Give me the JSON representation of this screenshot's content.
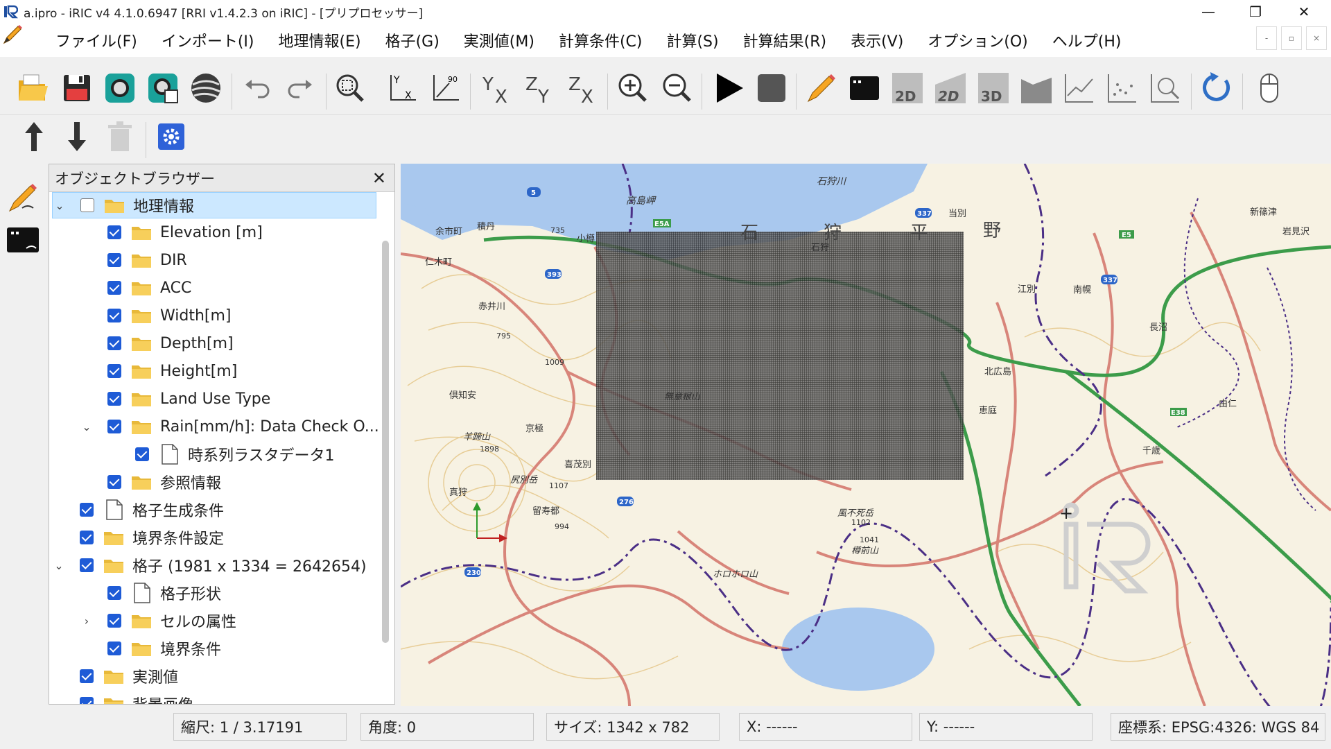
{
  "window": {
    "title": "a.ipro - iRIC v4 4.1.0.6947 [RRI v1.4.2.3 on iRIC] - [プリプロセッサー]"
  },
  "menu": [
    "ファイル(F)",
    "インポート(I)",
    "地理情報(E)",
    "格子(G)",
    "実測値(M)",
    "計算条件(C)",
    "計算(S)",
    "計算結果(R)",
    "表示(V)",
    "オプション(O)",
    "ヘルプ(H)"
  ],
  "toolbar": {
    "icons": [
      "open-folder",
      "save",
      "camera-snapshot",
      "continuous-snapshot",
      "google-earth",
      "undo",
      "redo",
      "zoom-fit",
      "view-xy",
      "view-rotate-90",
      "axis-yx",
      "axis-zy",
      "axis-zx",
      "zoom-in",
      "zoom-out",
      "run",
      "stop",
      "edit-pencil",
      "terminal",
      "2d",
      "2d-surface",
      "3d",
      "graph-area",
      "line-graph",
      "scatter-graph",
      "probe",
      "refresh",
      "mouse-help"
    ],
    "labels": {
      "view_2d": "2D",
      "view_2d_surface": "2D",
      "view_3d": "3D"
    }
  },
  "toolbar2": {
    "icons": [
      "move-up",
      "move-down",
      "delete",
      "settings"
    ]
  },
  "object_browser": {
    "title": "オブジェクトブラウザー",
    "items": [
      {
        "label": "地理情報",
        "level": 0,
        "expanded": true,
        "checked": false,
        "icon": "folder",
        "selected": true
      },
      {
        "label": "Elevation [m]",
        "level": 1,
        "checked": true,
        "icon": "folder"
      },
      {
        "label": "DIR",
        "level": 1,
        "checked": true,
        "icon": "folder"
      },
      {
        "label": "ACC",
        "level": 1,
        "checked": true,
        "icon": "folder"
      },
      {
        "label": "Width[m]",
        "level": 1,
        "checked": true,
        "icon": "folder"
      },
      {
        "label": "Depth[m]",
        "level": 1,
        "checked": true,
        "icon": "folder"
      },
      {
        "label": "Height[m]",
        "level": 1,
        "checked": true,
        "icon": "folder"
      },
      {
        "label": "Land Use Type",
        "level": 1,
        "checked": true,
        "icon": "folder"
      },
      {
        "label": "Rain[mm/h]: Data Check O...",
        "level": 1,
        "expanded": true,
        "checked": true,
        "icon": "folder"
      },
      {
        "label": "時系列ラスタデータ1",
        "level": 2,
        "checked": true,
        "icon": "document"
      },
      {
        "label": "参照情報",
        "level": 1,
        "checked": true,
        "icon": "folder"
      },
      {
        "label": "格子生成条件",
        "level": 0,
        "checked": true,
        "icon": "document"
      },
      {
        "label": "境界条件設定",
        "level": 0,
        "checked": true,
        "icon": "folder"
      },
      {
        "label": "格子 (1981 x 1334 = 2642654)",
        "level": 0,
        "expanded": true,
        "checked": true,
        "icon": "folder"
      },
      {
        "label": "格子形状",
        "level": 1,
        "checked": true,
        "icon": "document"
      },
      {
        "label": "セルの属性",
        "level": 1,
        "collapsed": true,
        "checked": true,
        "icon": "folder"
      },
      {
        "label": "境界条件",
        "level": 1,
        "checked": true,
        "icon": "folder"
      },
      {
        "label": "実測値",
        "level": 0,
        "checked": true,
        "icon": "folder"
      },
      {
        "label": "背景画像",
        "level": 0,
        "checked": true,
        "icon": "folder"
      }
    ]
  },
  "map": {
    "labels": [
      "石狩川",
      "高島岬",
      "余市町",
      "積丹",
      "小樽",
      "仁木町",
      "赤井川",
      "石狩",
      "当別",
      "新篠津",
      "岩見沢",
      "江別",
      "長沼",
      "北広島",
      "千歳",
      "恵庭",
      "京極",
      "羊蹄山",
      "喜茂別",
      "倶知安",
      "真狩",
      "留寿都",
      "尻別岳",
      "風不死岳",
      "樽前山",
      "ホロホロ山",
      "南幌",
      "由仁",
      "無意根山",
      "野",
      "石",
      "狩",
      "平"
    ],
    "elevations": [
      "735",
      "795",
      "1009",
      "1898",
      "1107",
      "994",
      "1102",
      "1041"
    ],
    "routes": [
      "5",
      "393",
      "337",
      "276",
      "230",
      "E5A",
      "E5",
      "E38",
      "337"
    ]
  },
  "status": {
    "scale": "縮尺: 1 / 3.17191",
    "angle": "角度: 0",
    "size": "サイズ: 1342 x 782",
    "x": "X: ------",
    "y": "Y: ------",
    "crs": "座標系: EPSG:4326: WGS 84"
  },
  "colors": {
    "selection": "#cce8ff",
    "checkbox": "#1e5bd6",
    "folder": "#f4c542",
    "map_road": "#d8857a",
    "map_expressway": "#3c9c4a",
    "map_water": "#a9c8ee",
    "map_boundary": "#4b2f86",
    "grid_overlay": "#222222"
  }
}
